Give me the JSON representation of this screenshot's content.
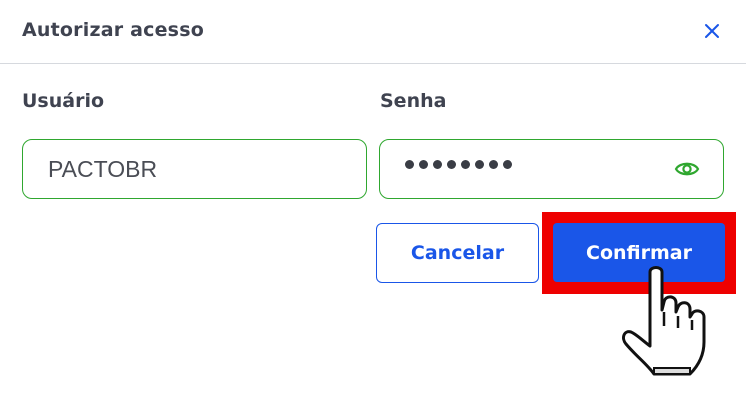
{
  "dialog": {
    "title": "Autorizar acesso",
    "close_icon": "close-icon"
  },
  "form": {
    "user_label": "Usuário",
    "user_value": "PACTOBR",
    "password_label": "Senha",
    "password_masked_length": 8,
    "password_toggle_icon": "eye-icon"
  },
  "actions": {
    "cancel_label": "Cancelar",
    "confirm_label": "Confirmar"
  },
  "colors": {
    "accent": "#1a56e8",
    "field_border": "#2fa72f",
    "highlight": "#ee0000",
    "text": "#3f4350"
  },
  "overlay": {
    "cursor_icon": "hand-pointer-icon"
  }
}
